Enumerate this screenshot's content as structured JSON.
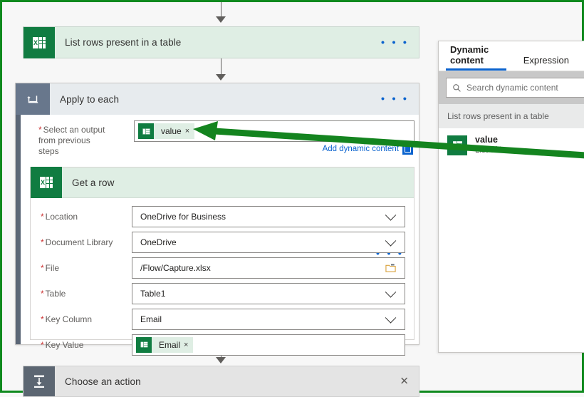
{
  "colors": {
    "excel_green": "#107c41",
    "token_green": "#dfeee4",
    "accent_blue": "#0b63ce",
    "annotation_green": "#14841f",
    "page_border_green": "#0f8a1e",
    "loop_grey": "#68778c"
  },
  "flow": {
    "list_rows_node": {
      "title": "List rows present in a table",
      "icon": "excel-icon",
      "menu": "• • •"
    },
    "apply_to_each_node": {
      "title": "Apply to each",
      "icon": "loop-icon",
      "menu": "• • •",
      "select_output": {
        "label_line1": "Select an output",
        "label_line2": "from previous steps",
        "required_marker": "*",
        "token": {
          "text": "value",
          "remove": "×",
          "icon": "excel-icon"
        },
        "add_dynamic_content": "Add dynamic content",
        "badge_icon": "dynamic-content-badge-icon"
      }
    },
    "get_a_row_node": {
      "title": "Get a row",
      "icon": "excel-icon",
      "menu": "• • •",
      "fields": [
        {
          "label": "Location",
          "value": "OneDrive for Business",
          "control": "dropdown",
          "required": "*"
        },
        {
          "label": "Document Library",
          "value": "OneDrive",
          "control": "dropdown",
          "required": "*"
        },
        {
          "label": "File",
          "value": "/Flow/Capture.xlsx",
          "control": "filepicker",
          "required": "*"
        },
        {
          "label": "Table",
          "value": "Table1",
          "control": "dropdown",
          "required": "*"
        },
        {
          "label": "Key Column",
          "value": "Email",
          "control": "dropdown",
          "required": "*"
        },
        {
          "label": "Key Value",
          "value": "Email",
          "control": "token",
          "required": "*",
          "token_remove": "×"
        }
      ]
    },
    "choose_action_node": {
      "title": "Choose an action",
      "icon": "insert-action-icon",
      "close": "✕"
    }
  },
  "dynamic_panel": {
    "tabs": [
      {
        "label": "Dynamic content",
        "active": true
      },
      {
        "label": "Expression",
        "active": false
      }
    ],
    "search": {
      "placeholder": "Search dynamic content",
      "value": "",
      "icon": "search-icon"
    },
    "group_header": "List rows present in a table",
    "items": [
      {
        "name": "value",
        "subtitle": "List of Items",
        "icon": "excel-icon"
      }
    ]
  },
  "annotation": {
    "type": "arrow",
    "description": "green arrow pointing from the dynamic content value item to the value token"
  }
}
